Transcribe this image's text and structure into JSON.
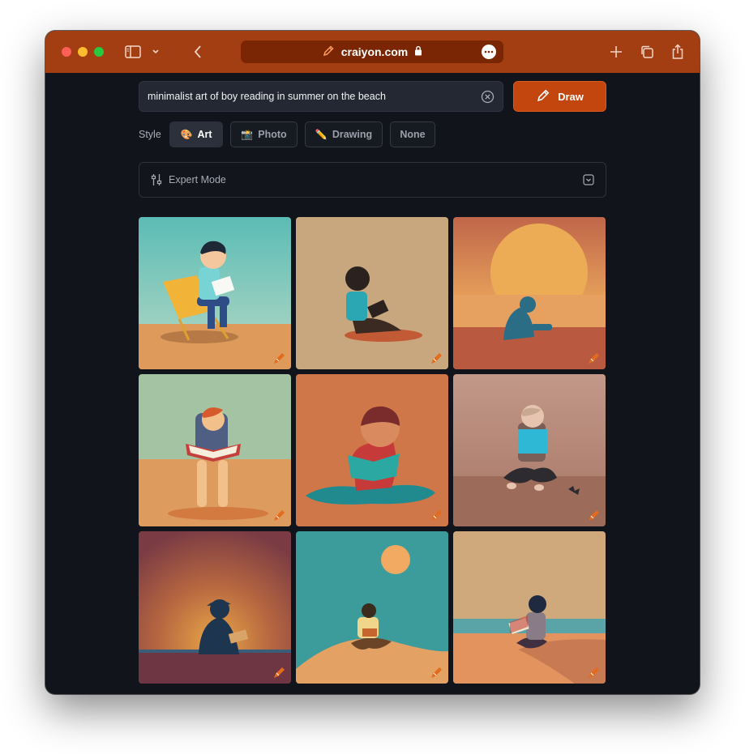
{
  "browser": {
    "url": "craiyon.com",
    "title_color": "#a23e12"
  },
  "prompt": {
    "value": "minimalist art of boy reading in summer on the beach"
  },
  "draw_button": {
    "label": "Draw"
  },
  "style": {
    "label": "Style",
    "options": [
      {
        "label": "Art",
        "emoji": "🎨",
        "selected": true
      },
      {
        "label": "Photo",
        "emoji": "📸",
        "selected": false
      },
      {
        "label": "Drawing",
        "emoji": "✏️",
        "selected": false
      },
      {
        "label": "None",
        "emoji": "",
        "selected": false
      }
    ]
  },
  "expert_mode": {
    "label": "Expert Mode"
  },
  "results": {
    "count": 9,
    "images": [
      "boy-in-beach-chair-reading",
      "boy-sitting-reading-tan",
      "boy-silhouette-sunset-sea",
      "redhead-boy-open-book",
      "boy-with-teal-book",
      "boy-cross-legged-blue-book",
      "boy-dusk-silhouette",
      "boy-on-dune-teal-sky-sun",
      "boy-on-shore-reading"
    ]
  },
  "colors": {
    "accent": "#c2460d",
    "background": "#11141a",
    "panel": "#232833"
  }
}
